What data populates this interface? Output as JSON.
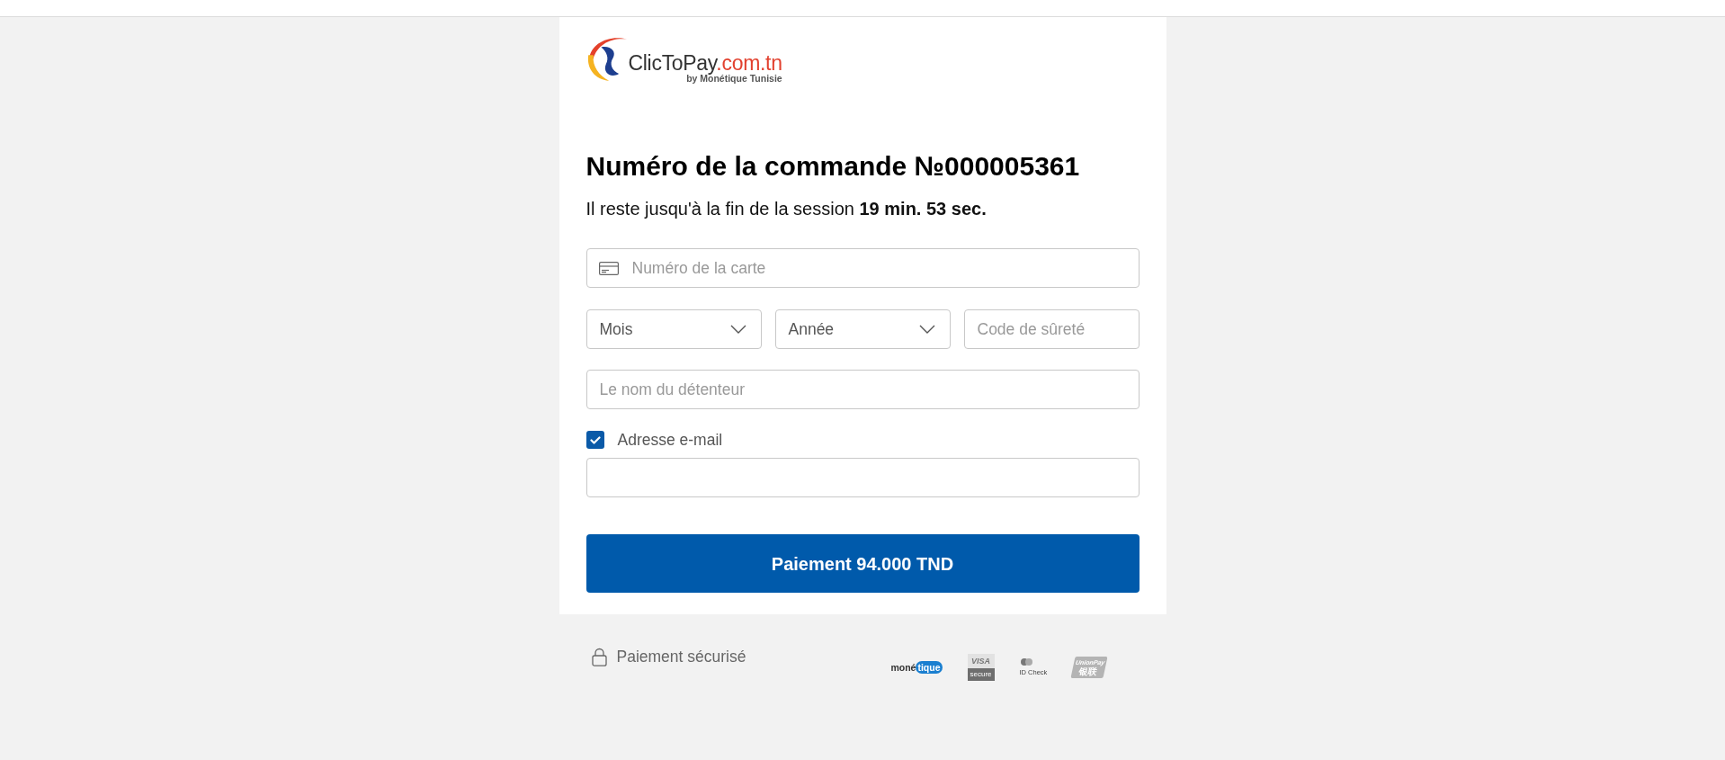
{
  "logo": {
    "name": "ClicToPay",
    "domain": ".com.tn",
    "tagline": "by Monétique Tunisie"
  },
  "order": {
    "title": "Numéro de la commande №000005361",
    "session_text": "Il reste jusqu'à la fin de la session **19 min. 53 sec.**"
  },
  "form": {
    "card_number": {
      "placeholder": "Numéro de la carte"
    },
    "month": {
      "value": "Mois"
    },
    "year": {
      "value": "Année"
    },
    "security_code": {
      "placeholder": "Code de sûreté"
    },
    "holder_name": {
      "placeholder": "Le nom du détenteur"
    },
    "email_option": {
      "label": "Adresse e-mail",
      "checked": true
    },
    "submit": {
      "label": "Paiement 94.000 TND"
    }
  },
  "footer": {
    "secure_label": "Paiement sécurisé",
    "badges": [
      {
        "kind": "monetique",
        "texts": [
          "moné",
          "tique"
        ]
      },
      {
        "kind": "visa",
        "texts": [
          "VISA",
          "secure"
        ]
      },
      {
        "kind": "idcheck",
        "texts": [
          "ID Check"
        ]
      },
      {
        "kind": "unionpay",
        "texts": [
          "UnionPay",
          "银联"
        ]
      }
    ]
  }
}
